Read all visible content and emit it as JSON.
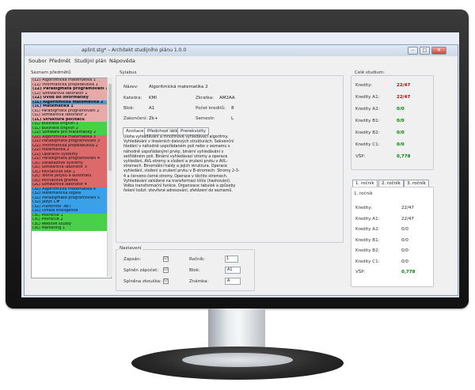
{
  "window": {
    "title": "aplint.stg* – Architekt studijního plánu 1.0.0",
    "buttons": {
      "minimize": "–",
      "maximize": "□",
      "close": "✕"
    }
  },
  "menu": [
    "Soubor",
    "Předmět",
    "Studijní plán",
    "Nápověda"
  ],
  "left": {
    "header": "Seznam předmětů",
    "subjects": [
      {
        "text": "(1Z) Algoritmická matematika 1",
        "color": "#e8a9a9"
      },
      {
        "text": "(1Z) Informatická propedeutika 1",
        "color": "#e8a9a9"
      },
      {
        "text": "(1Z) Paradigmata programování 1",
        "color": "#e8a9a9",
        "bold": true
      },
      {
        "text": "(1Z) Softwarová laboratoř 1",
        "color": "#e8a9a9"
      },
      {
        "text": "(1Z) Úvod do informatiky",
        "color": "#e8a9a9",
        "bold": true
      },
      {
        "text": "(1L) Algoritmická matematika 2",
        "color": "#3aa0e8",
        "bold": true
      },
      {
        "text": "(1L) Matematika 1",
        "color": "#e8a9a9",
        "bold": true
      },
      {
        "text": "(1L) Paradigmata programování 2",
        "color": "#e8a9a9"
      },
      {
        "text": "(1L) Softwarová laboratoř 2",
        "color": "#e8a9a9"
      },
      {
        "text": "(1L) Struktura počítačů",
        "color": "#e8a9a9",
        "bold": true
      },
      {
        "text": "(1L) Business English 1",
        "color": "#49d049"
      },
      {
        "text": "(1L) Business English 2",
        "color": "#49d049"
      },
      {
        "text": "(2Z) Software pro matematiky 2",
        "color": "#49d049"
      },
      {
        "text": "(2Z) Algoritmická matematika 3",
        "color": "#dd6a6a"
      },
      {
        "text": "(2Z) Paradigmata programování 3",
        "color": "#dd6a6a"
      },
      {
        "text": "(2Z) Informatická propedeutika 2",
        "color": "#dd6a6a"
      },
      {
        "text": "(2Z) Matematika 2",
        "color": "#dd6a6a"
      },
      {
        "text": "(2Z) Operační systémy",
        "color": "#dd6a6a"
      },
      {
        "text": "(2Z) Paradigmata programování 4",
        "color": "#dd6a6a"
      },
      {
        "text": "(2L) Databázové systémy",
        "color": "#dd6a6a"
      },
      {
        "text": "(2L) Softwarová laboratoř 3",
        "color": "#dd6a6a"
      },
      {
        "text": "(2L) Počítačové sítě 1",
        "color": "#dd6a6a"
      },
      {
        "text": "(2L) Teorie jazyků a automatů",
        "color": "#dd6a6a"
      },
      {
        "text": "(2L) Počítačová grafika",
        "color": "#dd6a6a"
      },
      {
        "text": "(2L) Softwarová laboratoř 4",
        "color": "#dd6a6a"
      },
      {
        "text": "(3Z) Algoritmická matematika 4",
        "color": "#3aa0e8"
      },
      {
        "text": "(3Z) Matematická logika",
        "color": "#3aa0e8"
      },
      {
        "text": "(3Z) Paradigmata programování 5",
        "color": "#3aa0e8"
      },
      {
        "text": "(3Z) Jazyk C#",
        "color": "#3aa0e8"
      },
      {
        "text": "(3Z) Platforma .NET",
        "color": "#3aa0e8"
      },
      {
        "text": "(3Z) Umělá inteligence",
        "color": "#3aa0e8"
      },
      {
        "text": "(3L) Pokročilé 1",
        "color": "#49d049"
      },
      {
        "text": "(3L) Pokročilé 2",
        "color": "#49d049"
      },
      {
        "text": "(3L) Webové služby",
        "color": "#49d049"
      },
      {
        "text": "(3L) Marketing 1",
        "color": "#49d049"
      }
    ]
  },
  "syllabus": {
    "header": "Sylabus",
    "fields": {
      "name_label": "Název:",
      "name_value": "Algoritmická matematika 2",
      "dept_label": "Katedra:",
      "dept_value": "KMI",
      "abbr_label": "Zkratka:",
      "abbr_value": "AM2AA",
      "block_label": "Blok:",
      "block_value": "A1",
      "credits_label": "Počet kreditů:",
      "credits_value": "8",
      "completion_label": "Zakončení:",
      "completion_value": "Zk+",
      "semester_label": "Semestr:",
      "semester_value": "L"
    },
    "tabs": [
      "Anotace",
      "Předchozí látky",
      "Prerekvizity"
    ],
    "description": "Úloha vyhledávání a množinové vyhledávací algoritmy. Vyhledávání v lineárních datových strukturách. Sekvenční hledání v náhodně uspořádaném poli nebo v seznamu s náhodně uspořádanými prvky, binární vyhledávání v setříděném poli. Binární vyhledávací stromy a operace vyhledání, AVL-stromy a vložení a zrušení prvku v AVL-stromech. Binomiální haldy a jejich struktura. Operace vyhledání, vložení a zrušení prvku v B-stromech. Stromy 2-3-4 a červeno-černé stromy. Operace v těchto stromech. Vyhledávání založené na transformaci klíče (hashování). Volba transformační funkce. Organizace tabulek a způsoby řešení kolizí: otevřené adresování, zřetězení do seznamů."
  },
  "settings": {
    "header": "Nastavení",
    "enrolled_label": "Zapsán:",
    "enrolled": "☑",
    "credit_label": "Splněn zápočet:",
    "credit": "☑",
    "exam_label": "Splněna zkouška:",
    "exam": "☑",
    "year_label": "Ročník:",
    "year_value": "1",
    "block_label": "Blok:",
    "block_value": "A1",
    "grade_label": "Známka:",
    "grade_value": "A"
  },
  "study": {
    "header": "Celé studium:",
    "rows": [
      {
        "label": "Kredity:",
        "value": "22/47",
        "status": "red"
      },
      {
        "label": "Kredity A1:",
        "value": "22/47",
        "status": "red"
      },
      {
        "label": "Kredity A2:",
        "value": "0/0",
        "status": "green"
      },
      {
        "label": "Kredity B1:",
        "value": "0/0",
        "status": "green"
      },
      {
        "label": "Kredity B2:",
        "value": "0/0",
        "status": "green"
      },
      {
        "label": "Kredity C1:",
        "value": "0/0",
        "status": "green"
      },
      {
        "label": "VŠP:",
        "value": "0,778",
        "status": "green"
      }
    ]
  },
  "year_tabs": {
    "tabs": [
      "1. ročník",
      "2. ročník",
      "3. ročník"
    ],
    "panel_title": "1. ročník",
    "rows": [
      {
        "label": "Kredity:",
        "value": "22/47",
        "status": "plain"
      },
      {
        "label": "Kredity A1:",
        "value": "22/47",
        "status": "plain"
      },
      {
        "label": "Kredity A2:",
        "value": "0/0",
        "status": "plain"
      },
      {
        "label": "Kredity B1:",
        "value": "0/0",
        "status": "plain"
      },
      {
        "label": "Kredity B2:",
        "value": "0/0",
        "status": "plain"
      },
      {
        "label": "Kredity C1:",
        "value": "0/0",
        "status": "plain"
      },
      {
        "label": "VŠP:",
        "value": "0,778",
        "status": "green"
      }
    ]
  },
  "colors": {
    "error": "#c00000",
    "ok": "#008000",
    "selection": "#3aa0e8"
  }
}
